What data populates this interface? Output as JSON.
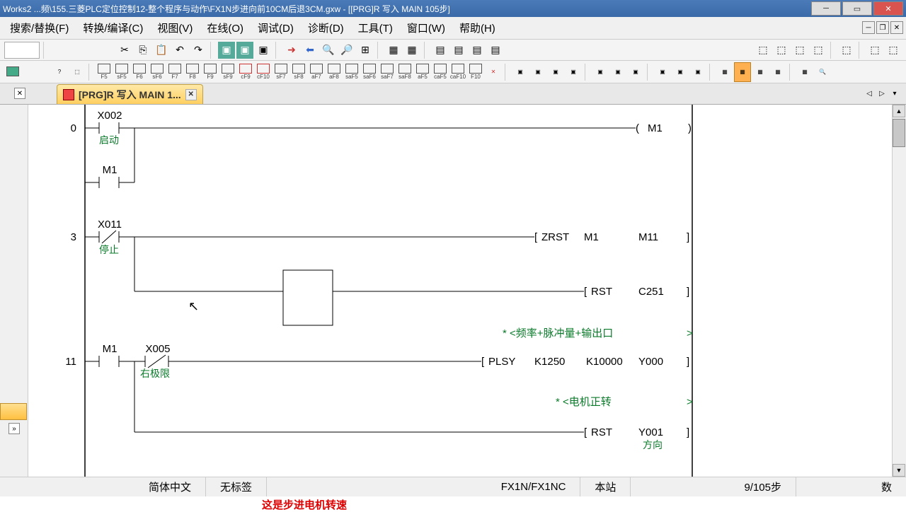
{
  "window": {
    "title": "Works2 ...频\\155.三菱PLC定位控制12-整个程序与动作\\FX1N步进向前10CM后退3CM.gxw - [[PRG]R 写入 MAIN 105步]"
  },
  "menu": {
    "search": "搜索/替换(F)",
    "convert": "转换/编译(C)",
    "view": "视图(V)",
    "online": "在线(O)",
    "debug": "调试(D)",
    "diagnose": "诊断(D)",
    "tool": "工具(T)",
    "window": "窗口(W)",
    "help": "帮助(H)"
  },
  "tab": {
    "label": "[PRG]R 写入 MAIN 1..."
  },
  "ladder": {
    "rungs": [
      {
        "step": "0",
        "contacts": [
          {
            "label": "X002",
            "comment": "启动",
            "type": "NO"
          },
          {
            "label": "M1",
            "comment": "",
            "type": "NO",
            "parallel": true
          }
        ],
        "output": {
          "type": "coil",
          "text": "M1"
        }
      },
      {
        "step": "3",
        "contacts": [
          {
            "label": "X011",
            "comment": "停止",
            "type": "NC"
          }
        ],
        "output": {
          "type": "bracket",
          "text": "ZRST    M1         M11"
        },
        "branch_output": {
          "type": "bracket",
          "text": "RST     C251"
        }
      },
      {
        "comment_line": "* <频率+脉冲量+输出口                     >"
      },
      {
        "step": "11",
        "contacts": [
          {
            "label": "M1",
            "comment": "",
            "type": "NO"
          },
          {
            "label": "X005",
            "comment": "右极限",
            "type": "NC"
          }
        ],
        "output": {
          "type": "bracket",
          "text": "PLSY    K1250    K10000    Y000"
        }
      },
      {
        "comment_line": "* <电机正转                                       >"
      },
      {
        "branch_output": {
          "type": "bracket",
          "text": "RST     Y001",
          "sub": "方向"
        }
      }
    ]
  },
  "status": {
    "lang": "简体中文",
    "tag": "无标签",
    "plc": "FX1N/FX1NC",
    "station": "本站",
    "step": "9/105步",
    "extra": "数"
  },
  "footer": {
    "red": "这是步进电机转速"
  }
}
